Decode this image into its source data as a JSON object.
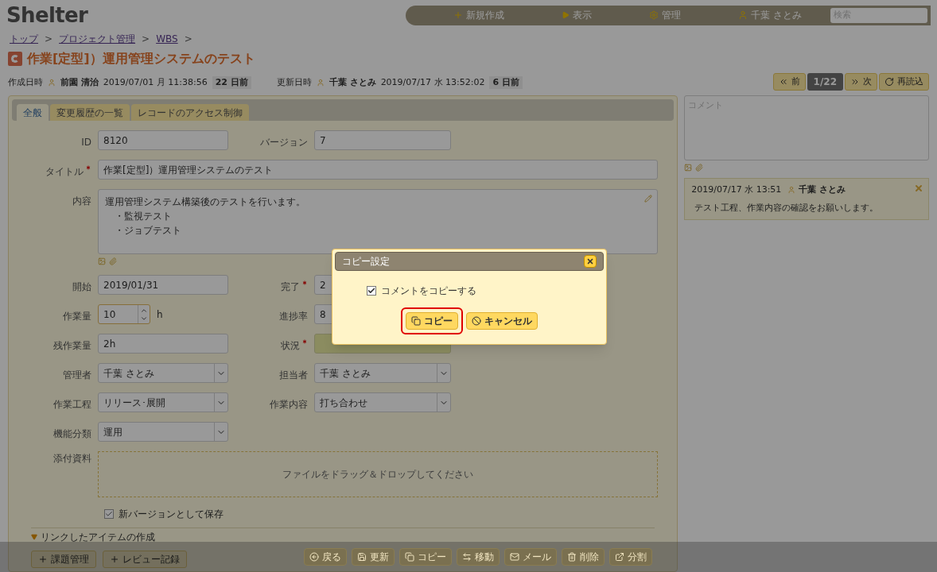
{
  "header": {
    "logo": "Shelter",
    "nav": [
      {
        "kind": "new",
        "label": "新規作成"
      },
      {
        "kind": "view",
        "label": "表示"
      },
      {
        "kind": "admin",
        "label": "管理"
      },
      {
        "kind": "user",
        "label": "千葉 さとみ"
      }
    ],
    "search": {
      "placeholder": "検索"
    }
  },
  "breadcrumb": [
    "トップ",
    "プロジェクト管理",
    "WBS"
  ],
  "breadcrumb_separator": ">",
  "title": "作業[定型]）運用管理システムのテスト",
  "meta": [
    {
      "label": "作成日時",
      "user": "前園 清治",
      "date": "2019/07/01 月 11:38:56",
      "ago": "22 日前"
    },
    {
      "label": "更新日時",
      "user": "千葉 さとみ",
      "date": "2019/07/17 水 13:52:02",
      "ago": "6 日前"
    }
  ],
  "record_nav": [
    {
      "kind": "prev",
      "label": "前"
    },
    {
      "kind": "counter",
      "label": "1/22"
    },
    {
      "kind": "next",
      "label": "次"
    },
    {
      "kind": "reload",
      "label": "再読込"
    }
  ],
  "tabs": [
    {
      "label": "全般",
      "selected": true
    },
    {
      "label": "変更履歴の一覧",
      "selected": false
    },
    {
      "label": "レコードのアクセス制御",
      "selected": false
    }
  ],
  "fields": [
    {
      "kind": "text",
      "label": "ID",
      "required": false,
      "value": "8120"
    },
    {
      "kind": "text",
      "label": "バージョン",
      "required": false,
      "value": "7"
    },
    {
      "kind": "wide",
      "label": "タイトル",
      "required": true,
      "value": "作業[定型]）運用管理システムのテスト"
    },
    {
      "kind": "textarea",
      "label": "内容",
      "required": false,
      "lines": [
        "運用管理システム構築後のテストを行います。",
        "　・監視テスト",
        "　・ジョブテスト"
      ]
    },
    {
      "kind": "text",
      "label": "開始",
      "required": false,
      "value": "2019/01/31"
    },
    {
      "kind": "text",
      "label": "完了",
      "required": true,
      "value": "2"
    },
    {
      "kind": "spinner",
      "label": "作業量",
      "required": false,
      "value": "10",
      "unit": "h"
    },
    {
      "kind": "text",
      "label": "進捗率",
      "required": false,
      "value": "8"
    },
    {
      "kind": "text",
      "label": "残作業量",
      "required": false,
      "value": "2h"
    },
    {
      "kind": "status",
      "label": "状況",
      "required": true
    },
    {
      "kind": "select",
      "label": "管理者",
      "required": false,
      "value": "千葉 さとみ"
    },
    {
      "kind": "select",
      "label": "担当者",
      "required": false,
      "value": "千葉 さとみ"
    },
    {
      "kind": "select",
      "label": "作業工程",
      "required": false,
      "value": "リリース･展開"
    },
    {
      "kind": "select",
      "label": "作業内容",
      "required": false,
      "value": "打ち合わせ"
    },
    {
      "kind": "select",
      "label": "機能分類",
      "required": false,
      "value": "運用"
    }
  ],
  "attachments": {
    "label": "添付資料",
    "dropzone": "ファイルをドラッグ＆ドロップしてください"
  },
  "new_version": {
    "label": "新バージョンとして保存",
    "checked": true
  },
  "links": {
    "title": "リンクしたアイテムの作成",
    "expanded": true,
    "buttons": [
      "課題管理",
      "レビュー記録"
    ]
  },
  "comments": {
    "placeholder": "コメント",
    "items": [
      {
        "date": "2019/07/17 水 13:51",
        "user": "千葉 さとみ",
        "text": "テスト工程、作業内容の確認をお願いします。"
      }
    ]
  },
  "toolbar": [
    {
      "kind": "back",
      "label": "戻る"
    },
    {
      "kind": "save",
      "label": "更新"
    },
    {
      "kind": "copy",
      "label": "コピー"
    },
    {
      "kind": "move",
      "label": "移動"
    },
    {
      "kind": "mail",
      "label": "メール"
    },
    {
      "kind": "delete",
      "label": "削除"
    },
    {
      "kind": "split",
      "label": "分割"
    }
  ],
  "dialog": {
    "title": "コピー設定",
    "option": {
      "label": "コメントをコピーする",
      "checked": true
    },
    "buttons": [
      {
        "kind": "copy",
        "label": "コピー",
        "highlighted": true
      },
      {
        "kind": "cancel",
        "label": "キャンセル",
        "highlighted": false
      }
    ]
  }
}
